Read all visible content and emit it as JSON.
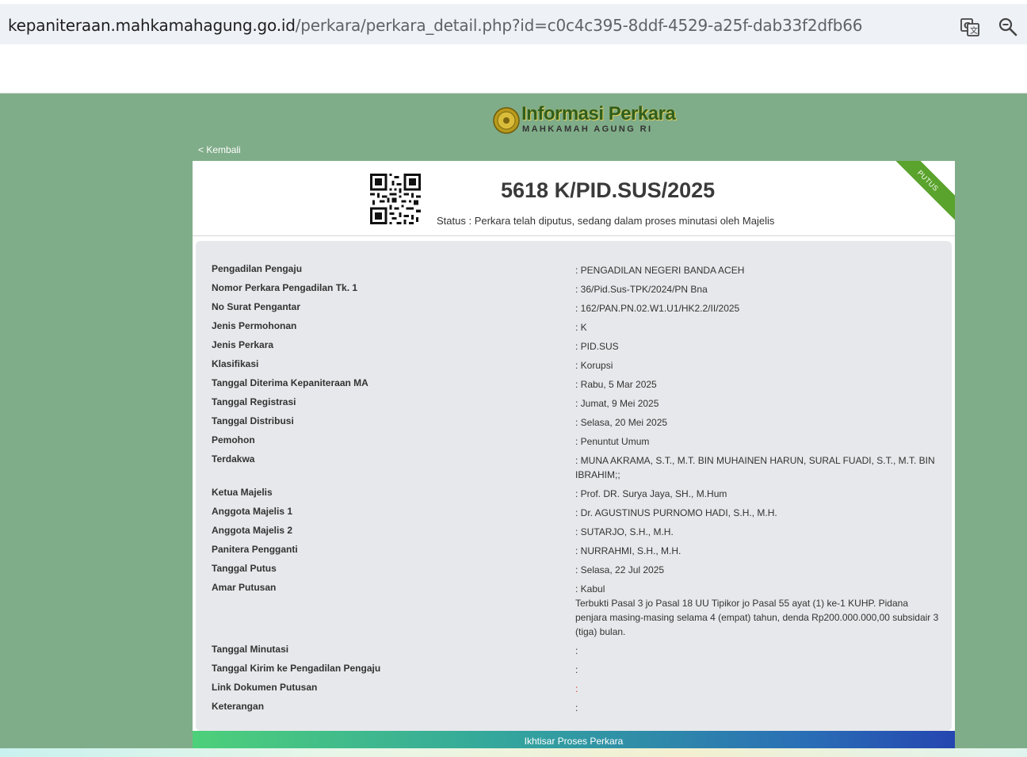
{
  "browser": {
    "url_host": "kepaniteraan.mahkamahagung.go.id",
    "url_path": "/perkara/perkara_detail.php?id=c0c4c395-8ddf-4529-a25f-dab33f2dfb66",
    "icons": [
      "translate-icon",
      "zoom-icon"
    ]
  },
  "header": {
    "logo_title": "Informasi Perkara",
    "logo_subtitle": "MAHKAMAH AGUNG RI",
    "back_link": "< Kembali"
  },
  "case": {
    "ribbon": "PUTUS",
    "number": "5618 K/PID.SUS/2025",
    "status": "Status : Perkara telah diputus, sedang dalam proses minutasi oleh Majelis"
  },
  "details": [
    {
      "label": "Pengadilan Pengaju",
      "value": ": PENGADILAN NEGERI BANDA ACEH"
    },
    {
      "label": "Nomor Perkara Pengadilan Tk. 1",
      "value": ": 36/Pid.Sus-TPK/2024/PN Bna"
    },
    {
      "label": "No Surat Pengantar",
      "value": ": 162/PAN.PN.02.W1.U1/HK2.2/II/2025"
    },
    {
      "label": "Jenis Permohonan",
      "value": ": K"
    },
    {
      "label": "Jenis Perkara",
      "value": ": PID.SUS"
    },
    {
      "label": "Klasifikasi",
      "value": ": Korupsi"
    },
    {
      "label": "Tanggal Diterima Kepaniteraan MA",
      "value": ": Rabu, 5 Mar 2025"
    },
    {
      "label": "Tanggal Registrasi",
      "value": ": Jumat, 9 Mei 2025"
    },
    {
      "label": "Tanggal Distribusi",
      "value": ": Selasa, 20 Mei 2025"
    },
    {
      "label": "Pemohon",
      "value": ": Penuntut Umum"
    },
    {
      "label": "Terdakwa",
      "value": ": MUNA AKRAMA, S.T., M.T. BIN MUHAINEN HARUN, SURAL FUADI, S.T., M.T. BIN IBRAHIM;;"
    },
    {
      "label": "Ketua Majelis",
      "value": ": Prof. DR. Surya Jaya, SH., M.Hum"
    },
    {
      "label": "Anggota Majelis 1",
      "value": ": Dr. AGUSTINUS PURNOMO HADI, S.H., M.H."
    },
    {
      "label": "Anggota Majelis 2",
      "value": ": SUTARJO, S.H., M.H."
    },
    {
      "label": "Panitera Pengganti",
      "value": ": NURRAHMI, S.H., M.H."
    },
    {
      "label": "Tanggal Putus",
      "value": ": Selasa, 22 Jul 2025"
    },
    {
      "label": "Amar Putusan",
      "value": ": Kabul",
      "extra": "Terbukti Pasal 3 jo Pasal 18 UU Tipikor jo Pasal 55 ayat (1) ke-1 KUHP. Pidana penjara masing-masing selama 4 (empat) tahun, denda Rp200.000.000,00 subsidair 3 (tiga) bulan."
    },
    {
      "label": "Tanggal Minutasi",
      "value": ":"
    },
    {
      "label": "Tanggal Kirim ke Pengadilan Pengaju",
      "value": ":"
    },
    {
      "label": "Link Dokumen Putusan",
      "value": ":"
    },
    {
      "label": "Keterangan",
      "value": ":"
    }
  ],
  "footer": {
    "title": "Ikhtisar Proses Perkara"
  }
}
